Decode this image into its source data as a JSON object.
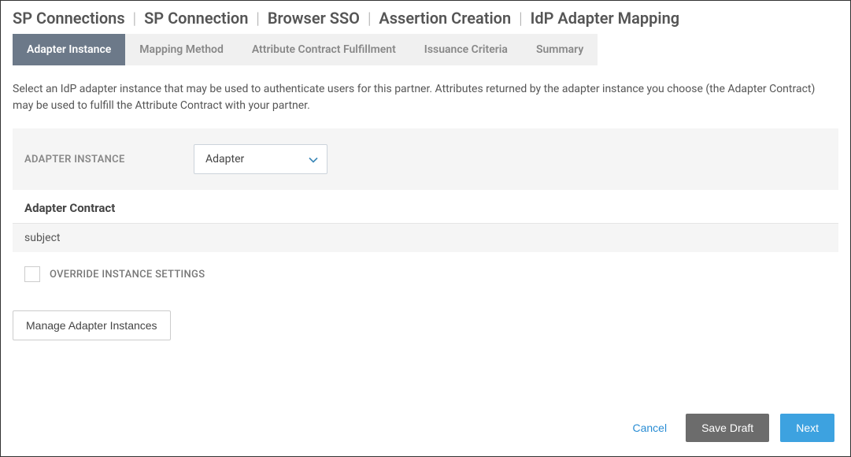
{
  "breadcrumb": {
    "items": [
      "SP Connections",
      "SP Connection",
      "Browser SSO",
      "Assertion Creation",
      "IdP Adapter Mapping"
    ]
  },
  "tabs": [
    {
      "label": "Adapter Instance",
      "active": true
    },
    {
      "label": "Mapping Method",
      "active": false
    },
    {
      "label": "Attribute Contract Fulfillment",
      "active": false
    },
    {
      "label": "Issuance Criteria",
      "active": false
    },
    {
      "label": "Summary",
      "active": false
    }
  ],
  "description": "Select an IdP adapter instance that may be used to authenticate users for this partner. Attributes returned by the adapter instance you choose (the Adapter Contract) may be used to fulfill the Attribute Contract with your partner.",
  "form": {
    "adapter_instance_label": "ADAPTER INSTANCE",
    "adapter_instance_value": "Adapter"
  },
  "contract": {
    "header": "Adapter Contract",
    "items": [
      "subject"
    ]
  },
  "override": {
    "label": "OVERRIDE INSTANCE SETTINGS",
    "checked": false
  },
  "buttons": {
    "manage": "Manage Adapter Instances",
    "cancel": "Cancel",
    "save_draft": "Save Draft",
    "next": "Next"
  }
}
